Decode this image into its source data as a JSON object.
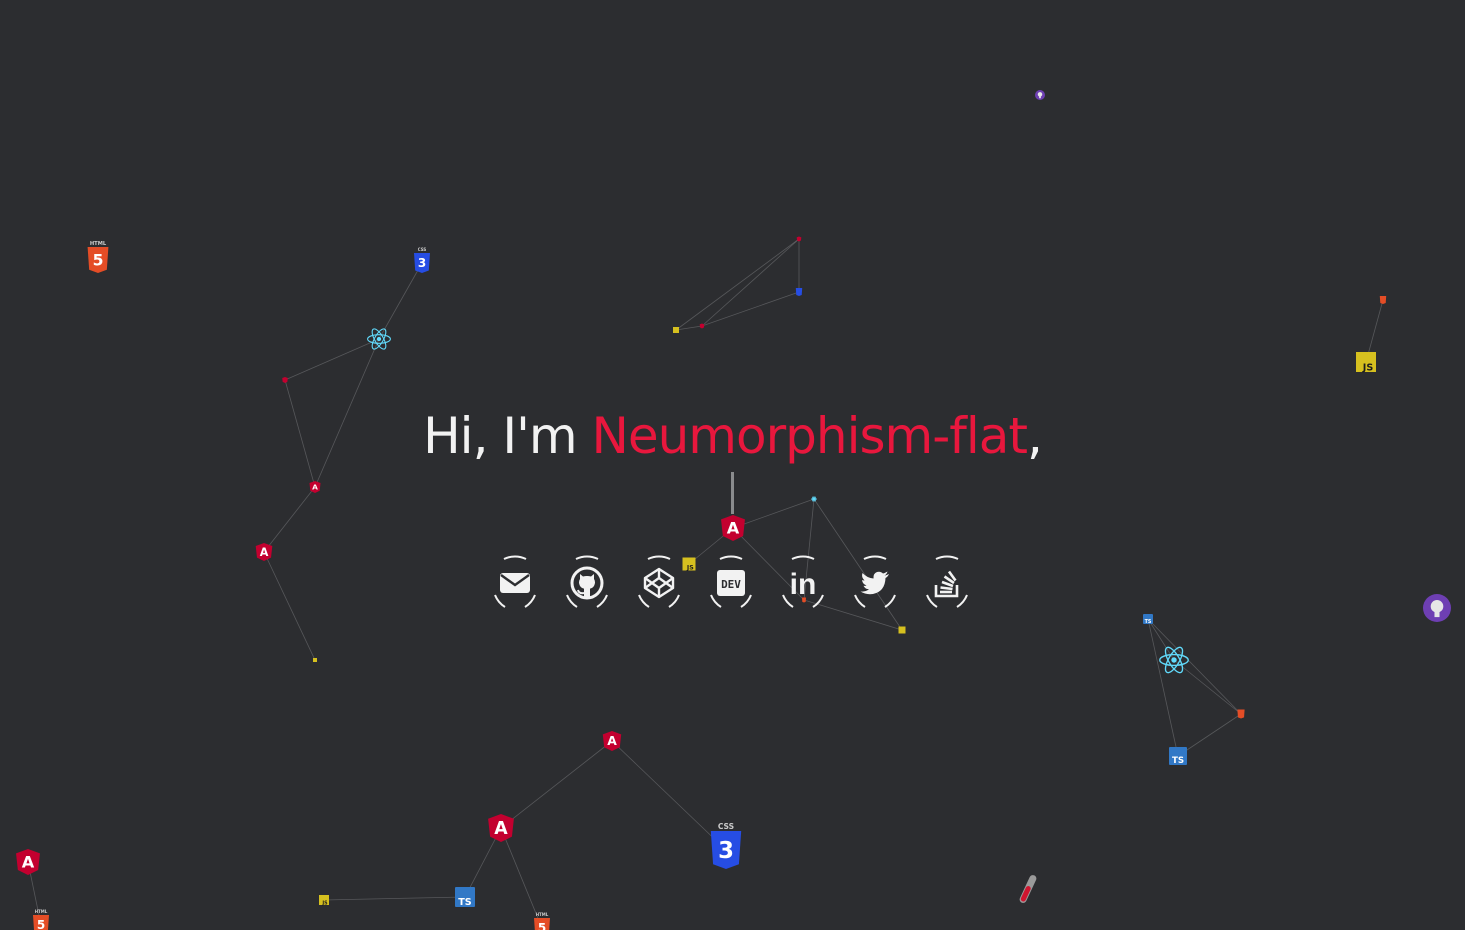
{
  "hero": {
    "greeting": "Hi, I'm ",
    "name": "Neumorphism-flat",
    "suffix": ","
  },
  "social_links": [
    {
      "name": "email",
      "icon": "envelope-icon"
    },
    {
      "name": "github",
      "icon": "github-icon"
    },
    {
      "name": "codepen",
      "icon": "codepen-icon"
    },
    {
      "name": "dev",
      "icon": "dev-icon",
      "label": "DEV"
    },
    {
      "name": "linkedin",
      "icon": "linkedin-icon",
      "label": "in"
    },
    {
      "name": "twitter",
      "icon": "twitter-icon"
    },
    {
      "name": "stackoverflow",
      "icon": "stackoverflow-icon"
    }
  ],
  "background_icons": {
    "html5_label": "HTML",
    "css3_label": "CSS",
    "js_label": "JS",
    "ts_label": "TS",
    "angular_label": "A",
    "html5_glyph": "5",
    "css3_glyph": "3"
  },
  "colors": {
    "background": "#2c2d30",
    "accent": "#e8173d",
    "text": "#f2f2f2",
    "angular": "#c3002f",
    "html5": "#e44d26",
    "css3": "#264de4",
    "js": "#d6c01f",
    "ts": "#3178c6",
    "react": "#61dafb"
  }
}
